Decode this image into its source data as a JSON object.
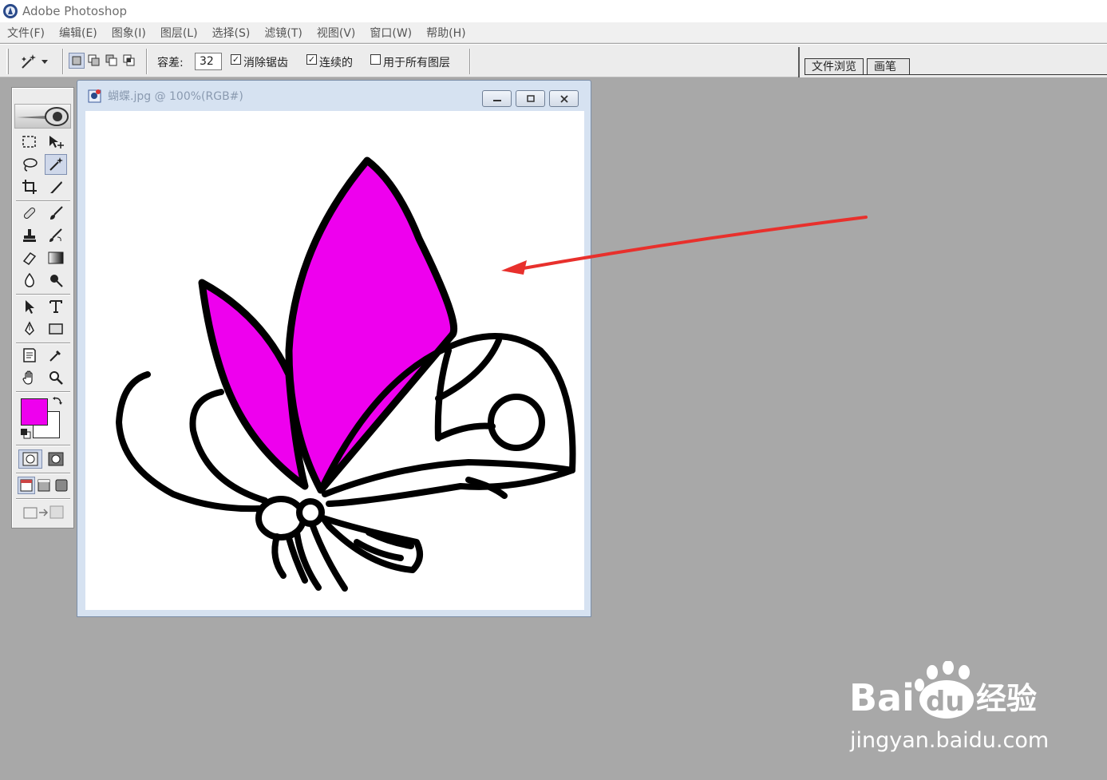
{
  "app": {
    "title": "Adobe Photoshop"
  },
  "menu": [
    "文件(F)",
    "编辑(E)",
    "图象(I)",
    "图层(L)",
    "选择(S)",
    "滤镜(T)",
    "视图(V)",
    "窗口(W)",
    "帮助(H)"
  ],
  "options": {
    "tolerance_label": "容差:",
    "tolerance_value": "32",
    "anti_alias_label": "消除锯齿",
    "anti_alias_checked": true,
    "contiguous_label": "连续的",
    "contiguous_checked": true,
    "all_layers_label": "用于所有图层",
    "all_layers_checked": false
  },
  "palette_well": {
    "tabs": [
      "文件浏览",
      "画笔"
    ]
  },
  "document": {
    "title": "蝴蝶.jpg @ 100%(RGB#)",
    "fill_color": "#ee00ee"
  },
  "colors": {
    "foreground": "#ee00ee",
    "background": "#ffffff",
    "arrow": "#e8302c"
  },
  "watermark": {
    "logo_text": "Bai du 经验",
    "url": "jingyan.baidu.com"
  }
}
